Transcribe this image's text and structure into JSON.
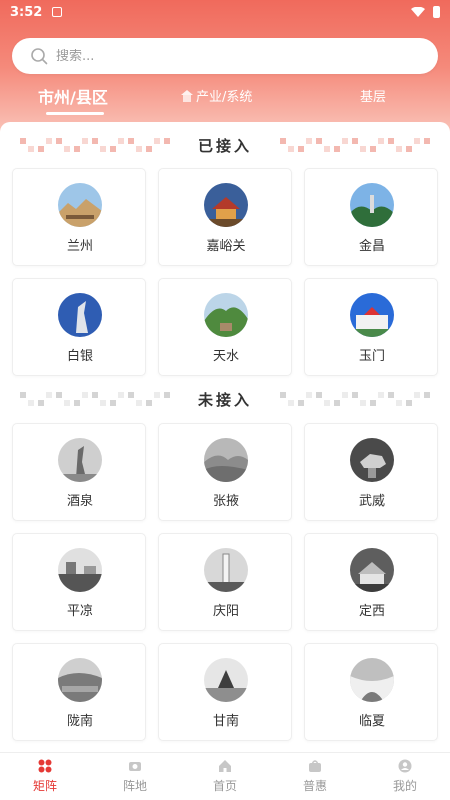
{
  "status": {
    "time": "3:52"
  },
  "search": {
    "placeholder": "搜索..."
  },
  "tabs": [
    {
      "label": "市州/县区"
    },
    {
      "label": "产业/系统"
    },
    {
      "label": "基层"
    }
  ],
  "sections": {
    "connected": "已接入",
    "not_connected": "未接入"
  },
  "connected_cities": [
    "兰州",
    "嘉峪关",
    "金昌",
    "白银",
    "天水",
    "玉门"
  ],
  "unconnected_cities": [
    "酒泉",
    "张掖",
    "武威",
    "平凉",
    "庆阳",
    "定西",
    "陇南",
    "甘南",
    "临夏"
  ],
  "bottom_nav": [
    {
      "label": "矩阵",
      "icon": "grid-icon"
    },
    {
      "label": "阵地",
      "icon": "camera-icon"
    },
    {
      "label": "首页",
      "icon": "home-icon"
    },
    {
      "label": "普惠",
      "icon": "bag-icon"
    },
    {
      "label": "我的",
      "icon": "user-icon"
    }
  ],
  "colors": {
    "accent": "#e53935",
    "hero_top": "#f06a5c",
    "hero_bottom": "#fbd2c8"
  }
}
